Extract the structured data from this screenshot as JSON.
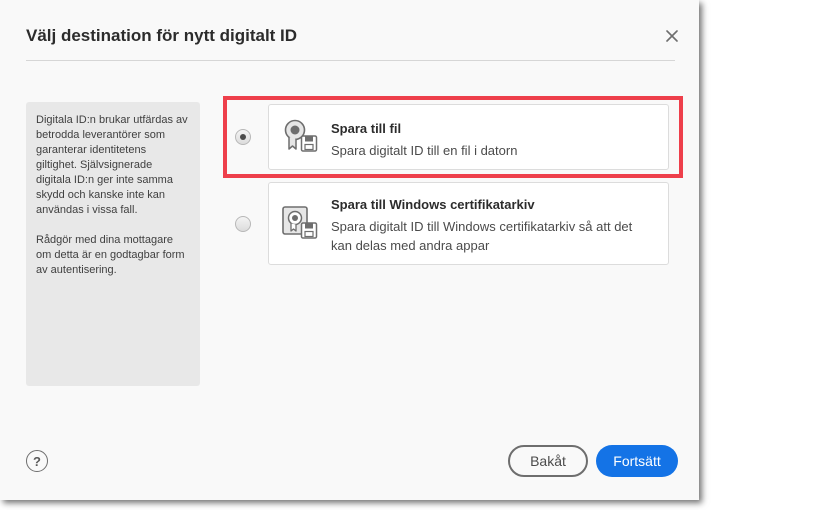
{
  "dialog": {
    "title": "Välj destination för nytt digitalt ID",
    "close_label": "×"
  },
  "info_panel": {
    "paragraph1": "Digitala ID:n brukar utfärdas av betrodda leverantörer som garanterar identitetens giltighet. Självsignerade digitala ID:n ger inte samma skydd och kanske inte kan användas i vissa fall.",
    "paragraph2": "Rådgör med dina mottagare om detta är en godtagbar form av autentisering."
  },
  "options": [
    {
      "title": "Spara till fil",
      "description": "Spara digitalt ID till en fil i datorn",
      "selected": true,
      "icon": "certificate-file-icon"
    },
    {
      "title": "Spara till Windows certifikatarkiv",
      "description": "Spara digitalt ID till Windows certifikatarkiv så att det kan delas med andra appar",
      "selected": false,
      "icon": "certificate-store-icon"
    }
  ],
  "footer": {
    "help_label": "?",
    "back_label": "Bakåt",
    "continue_label": "Fortsätt"
  },
  "colors": {
    "highlight": "#ee3f4b",
    "primary": "#1473e6",
    "dialog_bg": "#f9f9f9",
    "panel_bg": "#e8e8e8"
  }
}
